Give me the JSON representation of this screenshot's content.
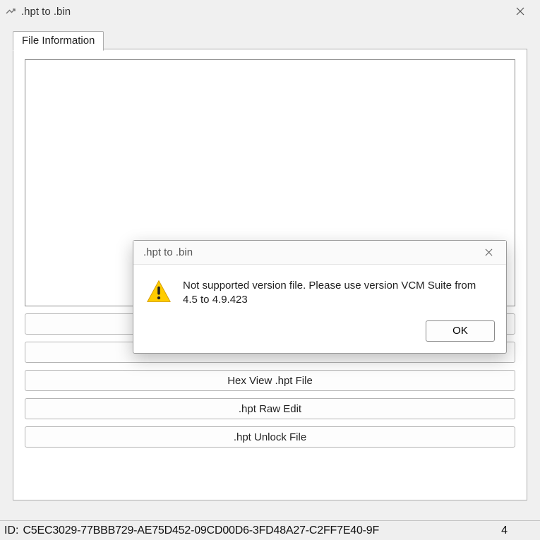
{
  "window": {
    "title": ".hpt to .bin"
  },
  "tab": {
    "label": "File Information"
  },
  "buttons": {
    "b1": "",
    "b2": "",
    "b3": "Hex View .hpt File",
    "b4": ".hpt Raw Edit",
    "b5": ".hpt Unlock File"
  },
  "dialog": {
    "title": ".hpt to .bin",
    "message": "Not supported version file. Please use version VCM Suite from 4.5 to 4.9.423",
    "ok": "OK"
  },
  "status": {
    "id_label": "ID:",
    "id_value": "C5EC3029-77BBB729-AE75D452-09CD00D6-3FD48A27-C2FF7E40-9F",
    "trailing": "4"
  }
}
